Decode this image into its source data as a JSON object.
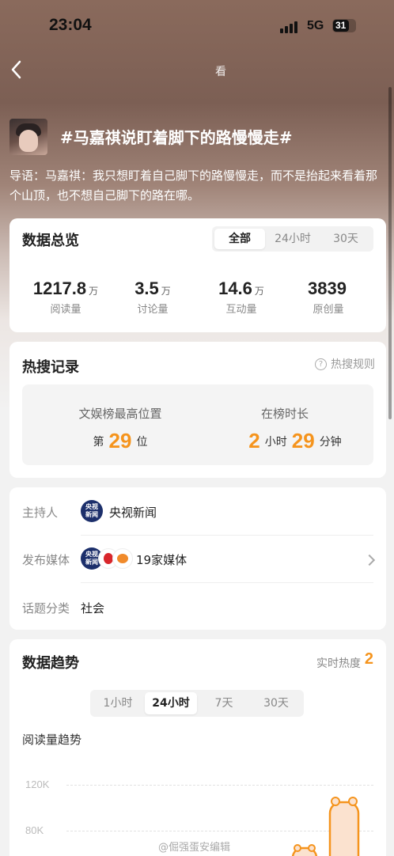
{
  "status_bar": {
    "time": "23:04",
    "network": "5G",
    "battery": "31"
  },
  "header": {
    "mark": "看"
  },
  "topic": {
    "title": "#马嘉祺说盯着脚下的路慢慢走#",
    "intro": "导语：马嘉祺：我只想盯着自己脚下的路慢慢走，而不是抬起来看着那个山顶，也不想自己脚下的路在哪。"
  },
  "overview": {
    "title": "数据总览",
    "tabs": [
      {
        "label": "全部",
        "active": true
      },
      {
        "label": "24小时",
        "active": false
      },
      {
        "label": "30天",
        "active": false
      }
    ],
    "stats": [
      {
        "value": "1217.8",
        "unit": "万",
        "label": "阅读量"
      },
      {
        "value": "3.5",
        "unit": "万",
        "label": "讨论量"
      },
      {
        "value": "14.6",
        "unit": "万",
        "label": "互动量"
      },
      {
        "value": "3839",
        "unit": "",
        "label": "原创量"
      }
    ]
  },
  "hot_record": {
    "title": "热搜记录",
    "rules_label": "热搜规则",
    "peak_label": "文娱榜最高位置",
    "peak_prefix": "第",
    "peak_value": "29",
    "peak_suffix": "位",
    "duration_label": "在榜时长",
    "duration_hours": "2",
    "hours_unit": "小时",
    "duration_minutes": "29",
    "minutes_unit": "分钟"
  },
  "info": {
    "host_label": "主持人",
    "host_name": "央视新闻",
    "host_badge": "央视\n新闻",
    "media_label": "发布媒体",
    "media_value": "19家媒体",
    "category_label": "话题分类",
    "category_value": "社会"
  },
  "trend": {
    "title": "数据趋势",
    "realtime_label": "实时热度",
    "realtime_value": "2",
    "tabs": [
      {
        "label": "1小时",
        "active": false
      },
      {
        "label": "24小时",
        "active": true
      },
      {
        "label": "7天",
        "active": false
      },
      {
        "label": "30天",
        "active": false
      }
    ],
    "subtitle": "阅读量趋势",
    "axis": [
      "120K",
      "80K"
    ]
  },
  "watermark": "@倔强蛋安编辑",
  "colors": {
    "accent": "#f5941d",
    "cctv": "#1c2f6b"
  }
}
